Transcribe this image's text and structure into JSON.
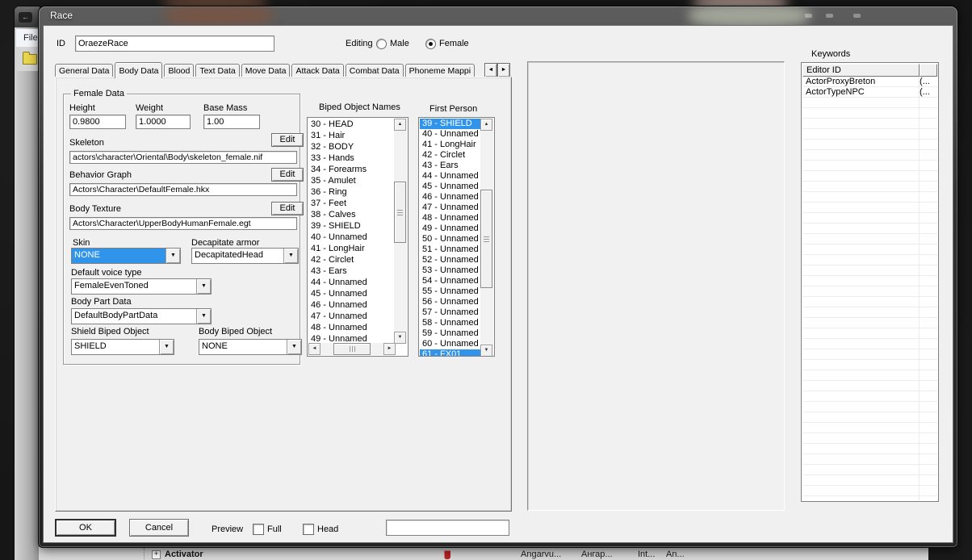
{
  "dialog": {
    "title": "Race",
    "id_label": "ID",
    "id_value": "OraezeRace",
    "editing_label": "Editing",
    "radio_male_label": "Male",
    "radio_female_label": "Female",
    "editing_selected": "Female",
    "tabs": [
      "General Data",
      "Body Data",
      "Blood",
      "Text Data",
      "Move Data",
      "Attack Data",
      "Combat Data",
      "Phoneme Mappi"
    ],
    "active_tab": "Body Data"
  },
  "female_data": {
    "group_title": "Female Data",
    "height_label": "Height",
    "height_value": "0.9800",
    "weight_label": "Weight",
    "weight_value": "1.0000",
    "base_mass_label": "Base Mass",
    "base_mass_value": "1.00",
    "skeleton_label": "Skeleton",
    "skeleton_value": "actors\\character\\Oriental\\Body\\skeleton_female.nif",
    "behavior_label": "Behavior Graph",
    "behavior_value": "Actors\\Character\\DefaultFemale.hkx",
    "body_texture_label": "Body Texture",
    "body_texture_value": "Actors\\Character\\UpperBodyHumanFemale.egt",
    "edit_button_label": "Edit",
    "skin_label": "Skin",
    "skin_value": "NONE",
    "decapitate_label": "Decapitate armor",
    "decapitate_value": "DecapitatedHead",
    "voice_label": "Default voice type",
    "voice_value": "FemaleEvenToned",
    "body_part_label": "Body Part Data",
    "body_part_value": "DefaultBodyPartData",
    "shield_biped_label": "Shield Biped Object",
    "shield_biped_value": "SHIELD",
    "body_biped_label": "Body Biped Object",
    "body_biped_value": "NONE"
  },
  "biped_list": {
    "title": "Biped Object Names",
    "items": [
      "30 - HEAD",
      "31 - Hair",
      "32 - BODY",
      "33 - Hands",
      "34 - Forearms",
      "35 - Amulet",
      "36 - Ring",
      "37 - Feet",
      "38 - Calves",
      "39 - SHIELD",
      "40 - Unnamed",
      "41 - LongHair",
      "42 - Circlet",
      "43 - Ears",
      "44 - Unnamed",
      "45 - Unnamed",
      "46 - Unnamed",
      "47 - Unnamed",
      "48 - Unnamed",
      "49 - Unnamed"
    ],
    "selected": []
  },
  "first_person_list": {
    "title": "First Person",
    "items": [
      "39 - SHIELD",
      "40 - Unnamed",
      "41 - LongHair",
      "42 - Circlet",
      "43 - Ears",
      "44 - Unnamed",
      "45 - Unnamed",
      "46 - Unnamed",
      "47 - Unnamed",
      "48 - Unnamed",
      "49 - Unnamed",
      "50 - Unnamed",
      "51 - Unnamed",
      "52 - Unnamed",
      "53 - Unnamed",
      "54 - Unnamed",
      "55 - Unnamed",
      "56 - Unnamed",
      "57 - Unnamed",
      "58 - Unnamed",
      "59 - Unnamed",
      "60 - Unnamed",
      "61 - FX01"
    ],
    "selected": [
      "39 - SHIELD",
      "61 - FX01"
    ]
  },
  "keywords": {
    "title": "Keywords",
    "column_header": "Editor ID",
    "rows": [
      {
        "editor_id": "ActorProxyBreton",
        "extra": "(..."
      },
      {
        "editor_id": "ActorTypeNPC",
        "extra": "(..."
      }
    ]
  },
  "footer": {
    "ok_label": "OK",
    "cancel_label": "Cancel",
    "preview_label": "Preview",
    "full_label": "Full",
    "head_label": "Head",
    "preview_field_value": ""
  },
  "background": {
    "file_menu_label": "File",
    "tree_item_label": "Activator",
    "tree_expand_glyph": "+",
    "columns": [
      "Angarvu...",
      "Ангар...",
      "Int...",
      "An..."
    ]
  },
  "icons": {
    "combo_arrow": "▼",
    "scroll_up": "▲",
    "scroll_down": "▼",
    "scroll_left": "◄",
    "scroll_right": "►",
    "tab_spin_left": "◄",
    "tab_spin_right": "►",
    "back_arrow": "←"
  },
  "colors": {
    "selection_blue": "#3094ea",
    "dialog_background": "#f0f0f0",
    "desktop_background": "#161616"
  }
}
